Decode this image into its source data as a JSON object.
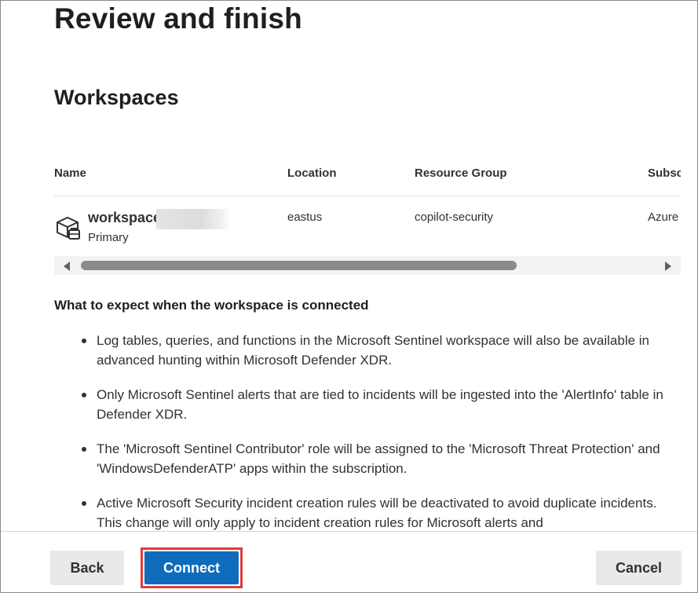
{
  "page": {
    "title": "Review and finish",
    "section_title": "Workspaces"
  },
  "table": {
    "columns": [
      "Name",
      "Location",
      "Resource Group",
      "Subsc"
    ],
    "rows": [
      {
        "name": "workspace",
        "subtitle": "Primary",
        "location": "eastus",
        "resource_group": "copilot-security",
        "subscription": "Azure",
        "icon": "workspace-cube-icon"
      }
    ]
  },
  "expectations": {
    "title": "What to expect when the workspace is connected",
    "items": [
      "Log tables, queries, and functions in the Microsoft Sentinel workspace will also be available in advanced hunting within Microsoft Defender XDR.",
      "Only Microsoft Sentinel alerts that are tied to incidents will be ingested into the 'AlertInfo' table in Defender XDR.",
      "The 'Microsoft Sentinel Contributor' role will be assigned to the 'Microsoft Threat Protection' and 'WindowsDefenderATP' apps within the subscription.",
      "Active Microsoft Security incident creation rules will be deactivated to avoid duplicate incidents. This change will only apply to incident creation rules for Microsoft alerts and"
    ]
  },
  "footer": {
    "back_label": "Back",
    "connect_label": "Connect",
    "cancel_label": "Cancel"
  },
  "colors": {
    "primary": "#0f6cbd",
    "highlight": "#e03c3c",
    "secondary_button": "#e9e9e9"
  }
}
